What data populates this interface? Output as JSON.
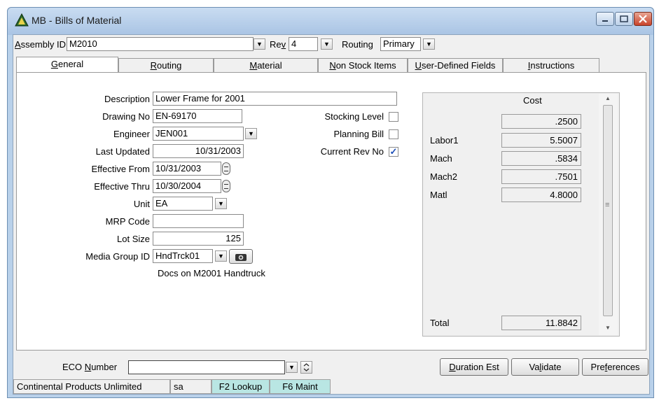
{
  "window": {
    "title": "MB - Bills of Material"
  },
  "header": {
    "assembly_label_key": "A",
    "assembly_label_rest": "ssembly ID",
    "assembly_value": "M2010",
    "rev_label_pre": "Re",
    "rev_label_key": "v",
    "rev_value": "4",
    "routing_label": "Routing",
    "routing_value": "Primary"
  },
  "tabs": [
    {
      "key": "G",
      "rest": "eneral"
    },
    {
      "key": "R",
      "rest": "outing"
    },
    {
      "key": "M",
      "rest": "aterial"
    },
    {
      "key": "N",
      "rest": "on Stock Items"
    },
    {
      "key": "U",
      "rest": "ser-Defined Fields"
    },
    {
      "key": "I",
      "rest": "nstructions"
    }
  ],
  "general": {
    "description_label": "Description",
    "description_value": "Lower Frame for 2001",
    "drawing_label": "Drawing No",
    "drawing_value": "EN-69170",
    "engineer_label": "Engineer",
    "engineer_value": "JEN001",
    "last_updated_label": "Last Updated",
    "last_updated_value": "10/31/2003",
    "effective_from_label": "Effective From",
    "effective_from_value": "10/31/2003",
    "effective_thru_label": "Effective Thru",
    "effective_thru_value": "10/30/2004",
    "unit_label": "Unit",
    "unit_value": "EA",
    "mrp_label": "MRP Code",
    "mrp_value": "",
    "lot_label": "Lot Size",
    "lot_value": "125",
    "media_label": "Media Group ID",
    "media_value": "HndTrck01",
    "media_doc": "Docs on M2001 Handtruck",
    "stocking_label": "Stocking Level",
    "stocking_checked": false,
    "planning_label": "Planning Bill",
    "planning_checked": false,
    "current_rev_label": "Current Rev No",
    "current_rev_checked": true,
    "check_mark": "✓"
  },
  "cost": {
    "header": "Cost",
    "rows": [
      {
        "label": "",
        "value": ".2500"
      },
      {
        "label": "Labor1",
        "value": "5.5007"
      },
      {
        "label": "Mach",
        "value": ".5834"
      },
      {
        "label": "Mach2",
        "value": ".7501"
      },
      {
        "label": "Matl",
        "value": "4.8000"
      }
    ],
    "total_label": "Total",
    "total_value": "11.8842"
  },
  "footer": {
    "eco_label_pre": "ECO ",
    "eco_label_key": "N",
    "eco_label_rest": "umber",
    "eco_value": "",
    "duration_key": "D",
    "duration_rest": "uration Est",
    "validate_pre": "Va",
    "validate_key": "l",
    "validate_rest": "idate",
    "preferences_pre": "Pre",
    "preferences_key": "f",
    "preferences_rest": "erences"
  },
  "status": {
    "company": "Continental Products Unlimited",
    "user": "sa",
    "f2": "F2 Lookup",
    "f6": "F6 Maint"
  },
  "glyphs": {
    "dropdown": "▼",
    "scroll_up": "▲",
    "scroll_down": "▼",
    "grip": "≡"
  }
}
